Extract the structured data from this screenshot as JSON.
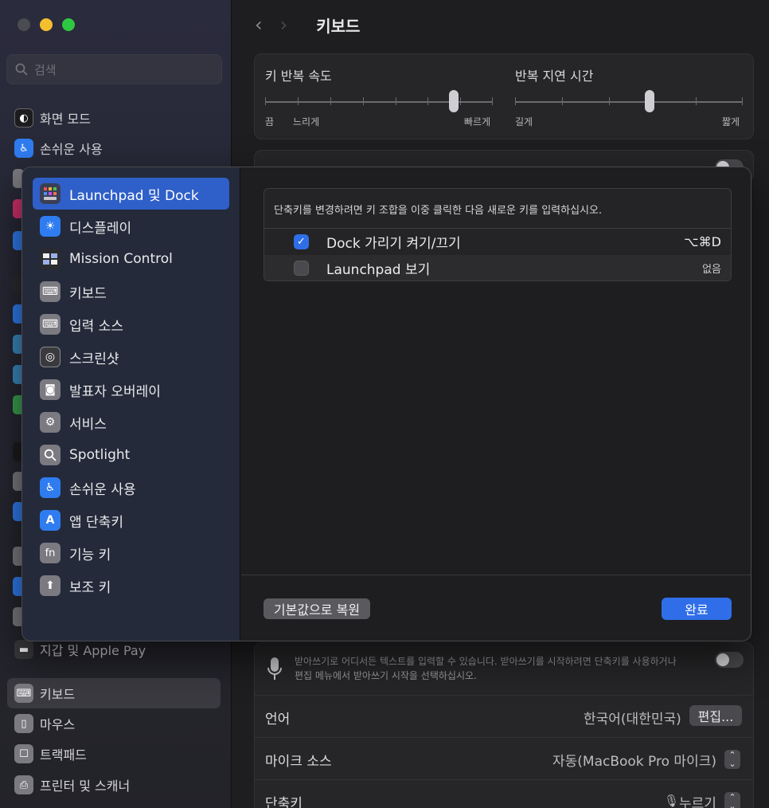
{
  "window": {
    "title": "키보드"
  },
  "sidebar": {
    "search_placeholder": "검색",
    "items_top": [
      {
        "label": "화면 모드",
        "icon": "appearance-icon"
      },
      {
        "label": "손쉬운 사용",
        "icon": "accessibility-icon"
      }
    ],
    "items_bottom": [
      {
        "label": "지갑 및 Apple Pay",
        "icon": "wallet-icon"
      },
      {
        "label": "키보드",
        "icon": "keyboard-icon"
      },
      {
        "label": "마우스",
        "icon": "mouse-icon"
      },
      {
        "label": "트랙패드",
        "icon": "trackpad-icon"
      },
      {
        "label": "프린터 및 스캐너",
        "icon": "printer-icon"
      }
    ]
  },
  "main": {
    "key_repeat": {
      "label": "키 반복 속도",
      "min_label": "끔",
      "slow_label": "느리게",
      "max_label": "빠르게",
      "value": 0.83
    },
    "repeat_delay": {
      "label": "반복 지연 시간",
      "min_label": "길게",
      "max_label": "짧게",
      "value": 0.59
    },
    "dictation": {
      "description_line1": "받아쓰기로 어디서든 텍스트를 입력할 수 있습니다. 받아쓰기를 시작하려면 단축키를 사용하거나",
      "description_line2": "편집 메뉴에서 받아쓰기 시작을 선택하십시오."
    },
    "language": {
      "label": "언어",
      "value": "한국어(대한민국)",
      "edit_label": "편집..."
    },
    "mic_source": {
      "label": "마이크 소스",
      "value": "자동(MacBook Pro 마이크)"
    },
    "shortcut": {
      "label": "단축키",
      "value": "누르기"
    }
  },
  "sheet": {
    "categories": [
      {
        "label": "Launchpad 및 Dock",
        "icon": "launchpad-icon",
        "color": "#3a3f55",
        "selected": true
      },
      {
        "label": "디스플레이",
        "icon": "display-icon",
        "color": "#2f7cf0"
      },
      {
        "label": "Mission Control",
        "icon": "mission-control-icon",
        "color": "#2b2b2e"
      },
      {
        "label": "키보드",
        "icon": "keyboard-icon",
        "color": "#7a7a80"
      },
      {
        "label": "입력 소스",
        "icon": "input-sources-icon",
        "color": "#7a7a80"
      },
      {
        "label": "스크린샷",
        "icon": "screenshot-icon",
        "color": "#3a3a3e"
      },
      {
        "label": "발표자 오버레이",
        "icon": "presenter-overlay-icon",
        "color": "#7a7a80"
      },
      {
        "label": "서비스",
        "icon": "services-icon",
        "color": "#7a7a80"
      },
      {
        "label": "Spotlight",
        "icon": "spotlight-icon",
        "color": "#7a7a80"
      },
      {
        "label": "손쉬운 사용",
        "icon": "accessibility-icon",
        "color": "#2f7cf0"
      },
      {
        "label": "앱 단축키",
        "icon": "app-shortcuts-icon",
        "color": "#2f7cf0"
      },
      {
        "label": "기능 키",
        "icon": "fn-key-icon",
        "color": "#7a7a80"
      },
      {
        "label": "보조 키",
        "icon": "modifier-keys-icon",
        "color": "#7a7a80"
      }
    ],
    "hint": "단축키를 변경하려면 키 조합을 이중 클릭한 다음 새로운 키를 입력하십시오.",
    "shortcuts": [
      {
        "label": "Dock 가리기 켜기/끄기",
        "checked": true,
        "keys": "⌥⌘D"
      },
      {
        "label": "Launchpad 보기",
        "checked": false,
        "keys": "없음"
      }
    ],
    "restore_label": "기본값으로 복원",
    "done_label": "완료"
  },
  "colors": {
    "accent": "#2f6ee8",
    "selection": "#2f5fc9"
  }
}
